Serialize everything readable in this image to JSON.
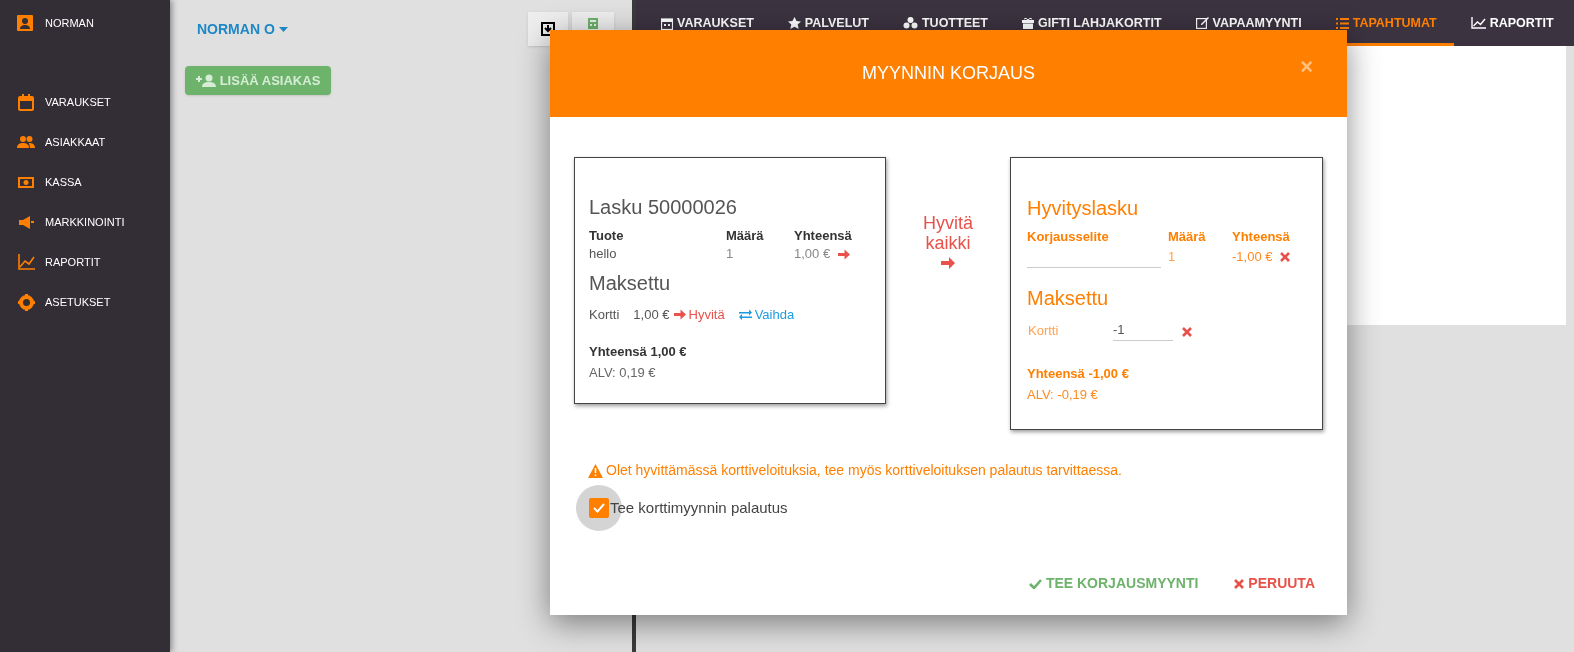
{
  "sidebar": {
    "user": "NORMAN",
    "items": [
      {
        "label": "VARAUKSET"
      },
      {
        "label": "ASIAKKAAT"
      },
      {
        "label": "KASSA"
      },
      {
        "label": "MARKKINOINTI"
      },
      {
        "label": "RAPORTIT"
      },
      {
        "label": "ASETUKSET"
      }
    ]
  },
  "customer_panel": {
    "user_menu": "NORMAN O",
    "add_button": "LISÄÄ ASIAKAS"
  },
  "nav_tabs": [
    {
      "label": "VARAUKSET",
      "selected": false
    },
    {
      "label": "PALVELUT",
      "selected": false
    },
    {
      "label": "TUOTTEET",
      "selected": false
    },
    {
      "label": "GIFTI LAHJAKORTIT",
      "selected": false
    },
    {
      "label": "VAPAAMYYNTI",
      "selected": false
    },
    {
      "label": "TAPAHTUMAT",
      "selected": true
    },
    {
      "label": "RAPORTIT",
      "selected": false
    }
  ],
  "dialog": {
    "title": "MYYNNIN KORJAUS",
    "close": "×",
    "invoice": {
      "title": "Lasku 50000026",
      "columns": [
        "Tuote",
        "Määrä",
        "Yhteensä"
      ],
      "rows": [
        {
          "product": "hello",
          "quantity": "1",
          "total": "1,00 €"
        }
      ],
      "paid_title": "Maksettu",
      "payments": [
        {
          "method": "Kortti",
          "amount": "1,00 €",
          "refund_link": "Hyvitä",
          "change_link": "Vaihda"
        }
      ],
      "total": "Yhteensä 1,00 €",
      "vat": "ALV: 0,19 €"
    },
    "refund_all": "Hyvitä kaikki",
    "credit_note": {
      "title": "Hyvityslasku",
      "columns": [
        "Korjausselite",
        "Määrä",
        "Yhteensä"
      ],
      "rows": [
        {
          "quantity": "1",
          "total": "-1,00 €"
        }
      ],
      "paid_title": "Maksettu",
      "payments": [
        {
          "method": "Kortti",
          "amount": "-1"
        }
      ],
      "total": "Yhteensä -1,00 €",
      "vat": "ALV: -0,19 €"
    },
    "warning": "Olet hyvittämässä korttiveloituksia, tee myös korttiveloituksen palautus tarvittaessa.",
    "card_refund": {
      "label": "Tee korttimyynnin palautus",
      "checked": true
    },
    "confirm_button": "TEE KORJAUSMYYNTI",
    "cancel_button": "PERUUTA"
  }
}
